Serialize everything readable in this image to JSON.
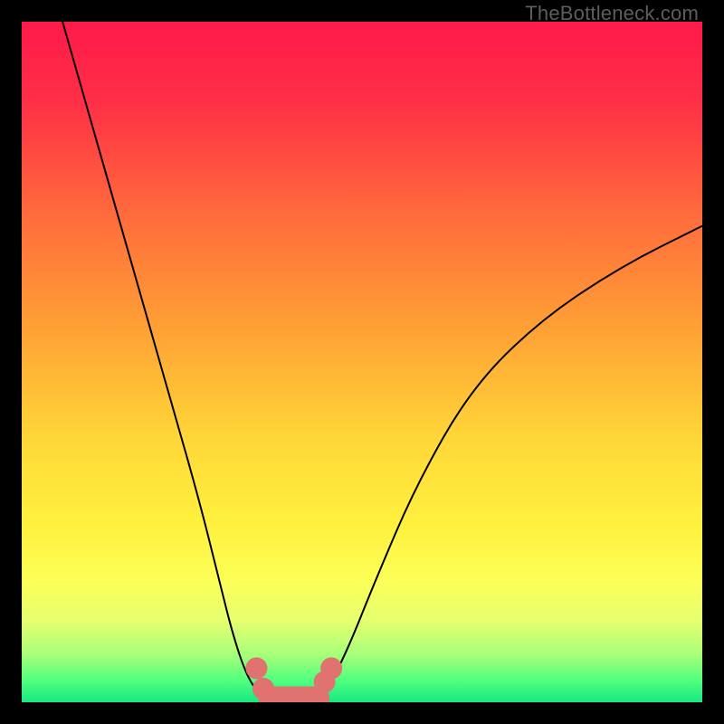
{
  "watermark": "TheBottleneck.com",
  "chart_data": {
    "type": "line",
    "title": "",
    "xlabel": "",
    "ylabel": "",
    "xlim": [
      0,
      100
    ],
    "ylim": [
      0,
      100
    ],
    "series": [
      {
        "name": "left-curve",
        "x": [
          6,
          10,
          14,
          18,
          22,
          26,
          29,
          31,
          33,
          35,
          37
        ],
        "y": [
          100,
          86,
          72,
          58,
          44,
          30,
          18,
          10,
          4,
          1,
          0
        ]
      },
      {
        "name": "right-curve",
        "x": [
          43,
          45,
          48,
          52,
          58,
          66,
          76,
          88,
          100
        ],
        "y": [
          0,
          2,
          8,
          18,
          32,
          46,
          56,
          64,
          70
        ]
      }
    ],
    "markers": {
      "name": "bottom-lobe",
      "points": [
        {
          "x": 34.5,
          "y": 5
        },
        {
          "x": 35.5,
          "y": 2
        },
        {
          "x": 44.5,
          "y": 3
        },
        {
          "x": 45.5,
          "y": 5
        }
      ],
      "sausage": {
        "x1": 36.5,
        "y1": 0.6,
        "x2": 43.5,
        "y2": 0.6
      }
    },
    "gradient_stops": [
      {
        "pct": 0,
        "color": "#ff1a4a"
      },
      {
        "pct": 12,
        "color": "#ff3046"
      },
      {
        "pct": 28,
        "color": "#ff6a3c"
      },
      {
        "pct": 45,
        "color": "#ffa035"
      },
      {
        "pct": 62,
        "color": "#ffd938"
      },
      {
        "pct": 74,
        "color": "#fff13e"
      },
      {
        "pct": 82,
        "color": "#fcff57"
      },
      {
        "pct": 88,
        "color": "#e6ff70"
      },
      {
        "pct": 93,
        "color": "#a8ff7a"
      },
      {
        "pct": 97,
        "color": "#4cff7e"
      },
      {
        "pct": 100,
        "color": "#18e782"
      }
    ]
  }
}
